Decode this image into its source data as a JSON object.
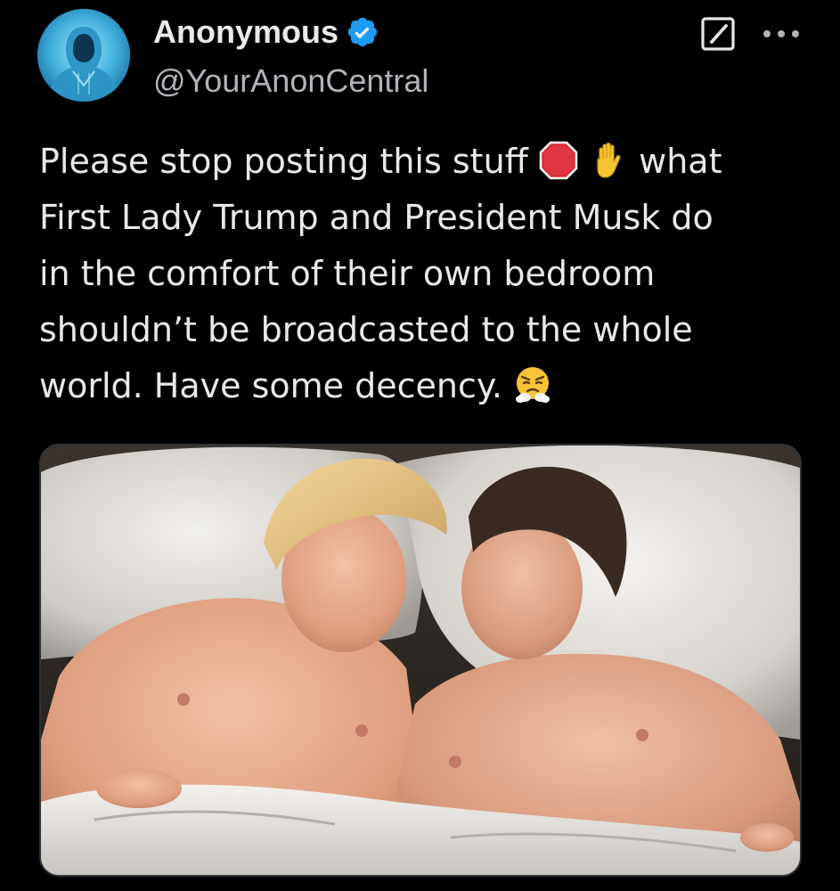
{
  "author": {
    "display_name": "Anonymous",
    "handle": "@YourAnonCentral",
    "verified": true,
    "verified_badge_color": "#1d9bf0",
    "avatar": "hooded-figure-avatar"
  },
  "actions": {
    "grok_icon": "grok-slash-icon",
    "more_icon": "more-dots-icon"
  },
  "tweet": {
    "line1_text": "Please stop posting this stuff",
    "line1_emoji1": "stop-sign-emoji",
    "line1_emoji2": "raised-hand-emoji",
    "line1_tail": "what",
    "line2": "First Lady Trump and President Musk do",
    "line3": "in the comfort of their own bedroom",
    "line4": "shouldn’t be broadcasted to the whole",
    "line5_text": "world. Have some decency.",
    "line5_emoji": "steam-from-nose-emoji"
  },
  "media": {
    "kind": "photo",
    "subject": "two shirtless men lying in bed"
  },
  "colors": {
    "background": "#000000",
    "text": "#e7e9ea",
    "secondary_text": "#b0b5ba",
    "border": "#2f3336"
  }
}
